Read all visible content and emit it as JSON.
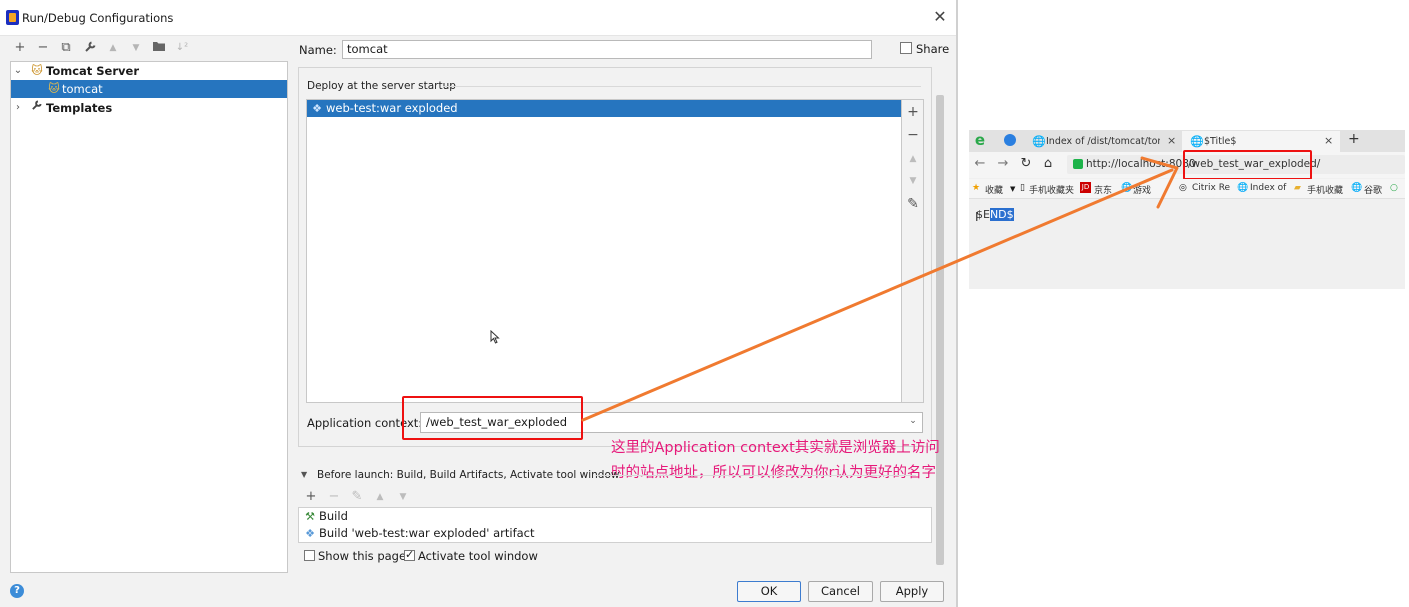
{
  "dialog": {
    "title": "Run/Debug Configurations",
    "toolbar": {
      "add": "+",
      "remove": "−",
      "copy": "⧉",
      "edit_defaults": "🔧",
      "move_up": "▲",
      "move_down": "▼",
      "folder": "▰",
      "sort": "↓²"
    },
    "tree": {
      "group_label": "Tomcat Server",
      "item_label": "tomcat",
      "templates_label": "Templates"
    },
    "name_label": "Name:",
    "name_value": "tomcat",
    "share_label": "Share",
    "deploy_section_label": "Deploy at the server startup",
    "deploy_item": "web-test:war exploded",
    "side_tools": {
      "add": "+",
      "remove": "−",
      "up": "▲",
      "down": "▼",
      "edit": "✎"
    },
    "app_context_label": "Application context:",
    "app_context_value": "/web_test_war_exploded",
    "before_launch_label": "Before launch: Build, Build Artifacts, Activate tool window",
    "before_tools": {
      "add": "+",
      "remove": "−",
      "edit": "✎",
      "up": "▲",
      "down": "▼"
    },
    "before_items": [
      "Build",
      "Build 'web-test:war exploded' artifact"
    ],
    "show_page_label": "Show this page",
    "activate_label": "Activate tool window",
    "buttons": {
      "ok": "OK",
      "cancel": "Cancel",
      "apply": "Apply"
    },
    "help": "?"
  },
  "annotation": {
    "text": "这里的Application context其实就是浏览器上访问时的站点地址，所以可以修改为你r认为更好的名字",
    "color": "#e6197a"
  },
  "browser": {
    "tab1_title": "Index of /dist/tomcat/tomc",
    "tab2_title": "$Title$",
    "tab_close": "×",
    "new_tab": "+",
    "address_host": "http://localhost:8080",
    "address_path": "/web_test_war_exploded/",
    "bookmarks": [
      "收藏",
      "手机收藏夹",
      "京东",
      "游戏",
      "Citrix Re",
      "Index of",
      "手机收藏",
      "谷歌"
    ],
    "page_prefix": "$E",
    "page_selected": "ND$"
  },
  "colors": {
    "selection": "#2675bf",
    "highlight_box": "#ee1111",
    "arrow": "#f07a30"
  }
}
